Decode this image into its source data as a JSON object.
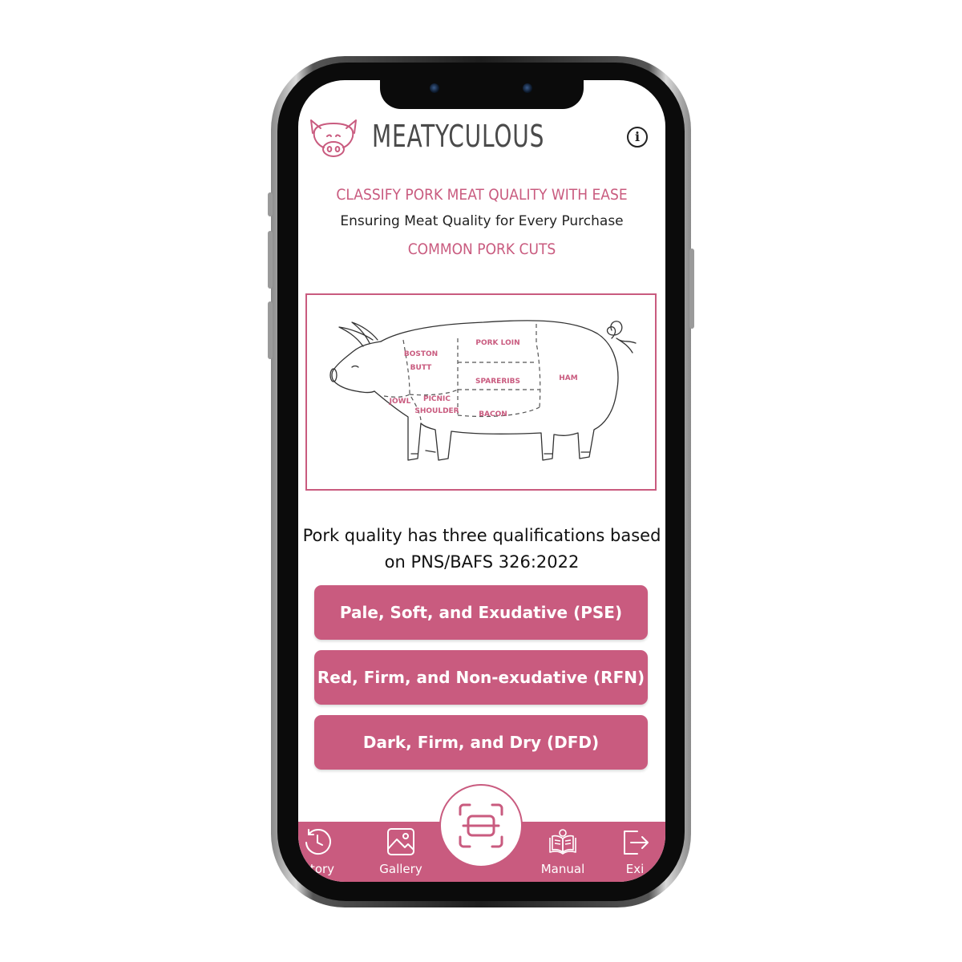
{
  "app": {
    "brand_name": "MEATYCULOUS",
    "accent_color": "#c95b7f",
    "logo_icon": "pig-face-icon",
    "info_icon": "info-circle-icon",
    "info_glyph": "i"
  },
  "header": {
    "headline": "CLASSIFY PORK MEAT QUALITY WITH EASE",
    "tagline": "Ensuring Meat Quality for Every Purchase",
    "section_title": "COMMON PORK CUTS"
  },
  "diagram": {
    "labels": {
      "boston": "BOSTON",
      "butt": "BUTT",
      "pork_loin": "PORK LOIN",
      "spareribs": "SPARERIBS",
      "ham": "HAM",
      "jowl": "JOWL",
      "picnic": "PICNIC",
      "shoulder": "SHOULDER",
      "bacon": "BACON"
    }
  },
  "qualifications": {
    "intro_line1": "Pork quality has three qualifications based",
    "intro_line2": "on PNS/BAFS 326:2022",
    "buttons": [
      {
        "label": "Pale, Soft, and Exudative (PSE)"
      },
      {
        "label": "Red, Firm, and Non-exudative (RFN)"
      },
      {
        "label": "Dark, Firm, and Dry (DFD)"
      }
    ]
  },
  "nav": {
    "items": [
      {
        "label": "istory",
        "icon": "history-clock-icon"
      },
      {
        "label": "Gallery",
        "icon": "gallery-image-icon"
      },
      {
        "label": "Manual",
        "icon": "manual-book-icon"
      },
      {
        "label": "Exi",
        "icon": "exit-icon"
      }
    ],
    "scan_icon": "scan-frame-icon"
  }
}
